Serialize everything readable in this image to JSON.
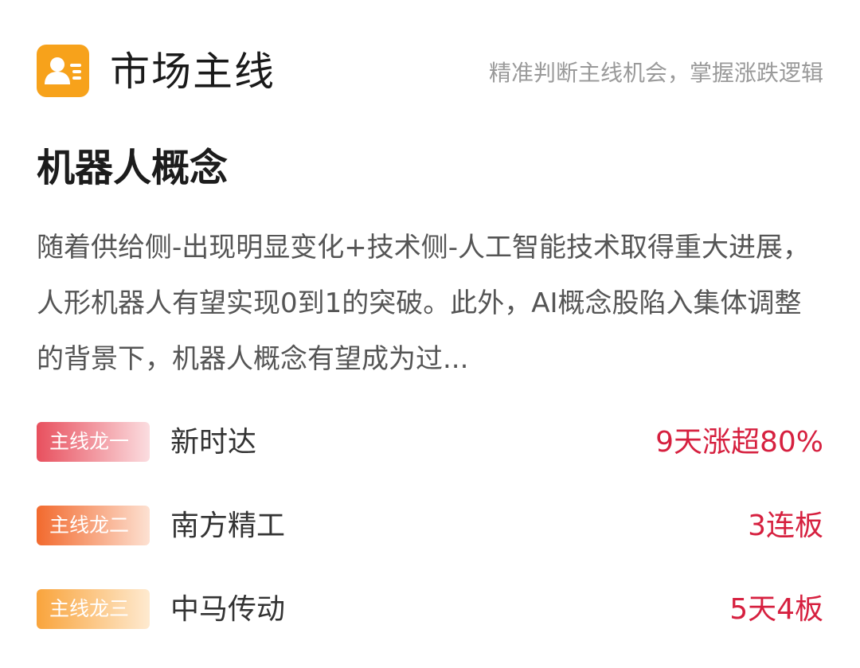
{
  "header": {
    "icon": "contact-card-icon",
    "title": "市场主线",
    "slogan": "精准判断主线机会，掌握涨跌逻辑"
  },
  "topic": {
    "title": "机器人概念",
    "description": "随着供给侧-出现明显变化+技术侧-人工智能技术取得重大进展，人形机器人有望实现0到1的突破。此外，AI概念股陷入集体调整的背景下，机器人概念有望成为过..."
  },
  "leaders": [
    {
      "badge": "主线龙一",
      "name": "新时达",
      "stat": "9天涨超80%",
      "badge_from": "#E8505E",
      "badge_to": "#FBDDE0",
      "stat_color": "#D6203F"
    },
    {
      "badge": "主线龙二",
      "name": "南方精工",
      "stat": "3连板",
      "badge_from": "#F26A2E",
      "badge_to": "#FDE1D2",
      "stat_color": "#D6203F"
    },
    {
      "badge": "主线龙三",
      "name": "中马传动",
      "stat": "5天4板",
      "badge_from": "#F9A43C",
      "badge_to": "#FEEAD0",
      "stat_color": "#D6203F"
    }
  ],
  "colors": {
    "icon_bg": "#F7A21B"
  }
}
